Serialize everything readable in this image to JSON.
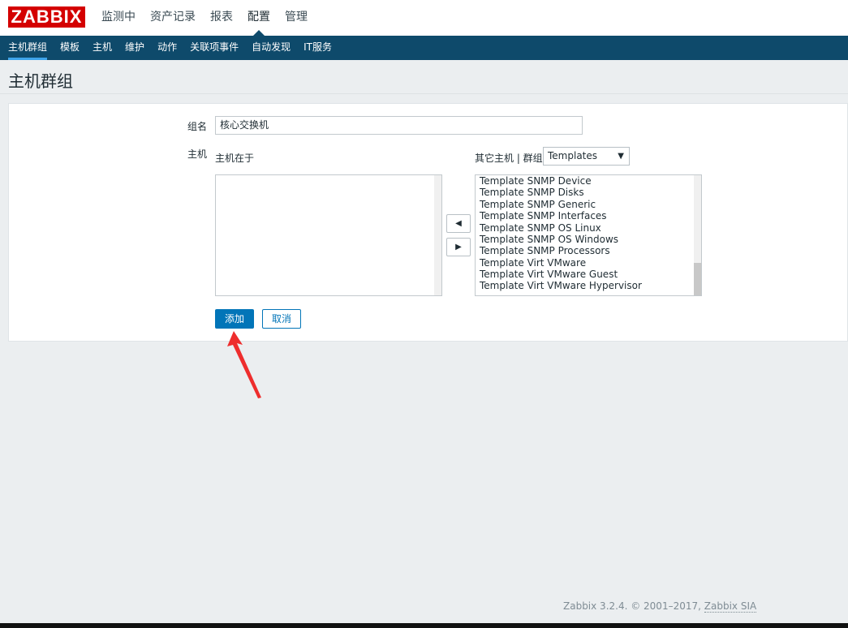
{
  "header": {
    "logo": "ZABBIX",
    "menu": [
      {
        "label": "监测中",
        "active": false
      },
      {
        "label": "资产记录",
        "active": false
      },
      {
        "label": "报表",
        "active": false
      },
      {
        "label": "配置",
        "active": true
      },
      {
        "label": "管理",
        "active": false
      }
    ]
  },
  "subnav": [
    {
      "label": "主机群组",
      "active": true
    },
    {
      "label": "模板",
      "active": false
    },
    {
      "label": "主机",
      "active": false
    },
    {
      "label": "维护",
      "active": false
    },
    {
      "label": "动作",
      "active": false
    },
    {
      "label": "关联项事件",
      "active": false
    },
    {
      "label": "自动发现",
      "active": false
    },
    {
      "label": "IT服务",
      "active": false
    }
  ],
  "page": {
    "title": "主机群组"
  },
  "form": {
    "group_name_label": "组名",
    "group_name_value": "核心交换机",
    "hosts_label": "主机",
    "in_hosts_label": "主机在于",
    "other_hosts_label": "其它主机 | 群组",
    "group_select_value": "Templates",
    "other_hosts": [
      "Template SNMP Device",
      "Template SNMP Disks",
      "Template SNMP Generic",
      "Template SNMP Interfaces",
      "Template SNMP OS Linux",
      "Template SNMP OS Windows",
      "Template SNMP Processors",
      "Template Virt VMware",
      "Template Virt VMware Guest",
      "Template Virt VMware Hypervisor"
    ],
    "move_left": "◀",
    "move_right": "▶",
    "add_button": "添加",
    "cancel_button": "取消"
  },
  "footer": {
    "text": "Zabbix 3.2.4. © 2001–2017,",
    "link": "Zabbix SIA"
  },
  "colors": {
    "logo_bg": "#d40000",
    "subnav_bg": "#0e4a6b",
    "primary": "#0275b8",
    "annotation_arrow": "#ee2d2d"
  }
}
